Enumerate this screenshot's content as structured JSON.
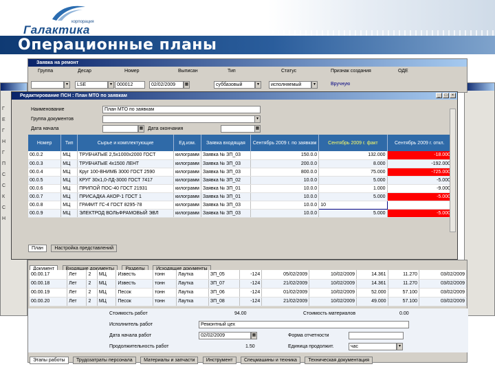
{
  "brand": {
    "logo_text": "Галактика",
    "logo_corp": "корпорация"
  },
  "slide_title": "Операционные планы",
  "zayavka_window": {
    "title": "Заявка на ремонт",
    "headers": [
      "Группа",
      "Десар",
      "Номер",
      "Выписан",
      "Тип",
      "Статус",
      "Признак создания",
      "ОДЕ"
    ],
    "row": {
      "group": "",
      "desar": "LSE",
      "number": "000012",
      "date": "02/02/2009",
      "type": "суббазовый",
      "status": "исполняемый",
      "creation": "Вручную"
    }
  },
  "psn_window": {
    "title": "Редактирование ПСН : План МТО по заявкам",
    "fields": {
      "name_label": "Наименование",
      "name_value": "План МТО по заявкам",
      "group_label": "Группа документов",
      "group_value": "",
      "start_label": "Дата начала",
      "start_value": "",
      "end_label": "Дата окончания",
      "end_value": ""
    },
    "columns": [
      "Номер",
      "Тип",
      "Сырье и комплектующие",
      "Ед.изм.",
      "Заявка входящая",
      "Сентябрь 2009 г. по заявкам",
      "Сентябрь 2009 г. факт",
      "Сентябрь 2009 г. откл."
    ],
    "rows": [
      [
        "00.0.2",
        "МЦ",
        "ТРУБЧАТЫЕ 2,5х1000х2000 ГОСТ",
        "килограмм",
        "Заявка № ЗП_03",
        "150.0.0",
        "132.000",
        "-18.000",
        "red"
      ],
      [
        "00.0.3",
        "МЦ",
        "ТРУБЧАТЫЕ 4х1500 ЛЕНТ",
        "килограмм",
        "Заявка № ЗП_03",
        "200.0.0",
        "8.000",
        "-192.000",
        "white"
      ],
      [
        "00.0.4",
        "МЦ",
        "Круг 100-ВНИМБ 3000 ГОСТ 2590",
        "килограмм",
        "Заявка № ЗП_03",
        "800.0.0",
        "75.000",
        "-725.000",
        "red"
      ],
      [
        "00.0.5",
        "МЦ",
        "КРУГ 30х1,0-ЛД-3000 ГОСТ 7417",
        "килограмм",
        "Заявка № ЗП_02",
        "10.0.0",
        "5.000",
        "-5.000",
        "white"
      ],
      [
        "00.0.6",
        "МЦ",
        "ПРИПОЙ ПОС-40 ГОСТ 21931",
        "килограмм",
        "Заявка № ЗП_01",
        "10.0.0",
        "1.000",
        "-9.000",
        "white"
      ],
      [
        "00.0.7",
        "МЦ",
        "ПРИСАДКА АКОР-1 ГОСТ 1",
        "килограмм",
        "Заявка № ЗП_01",
        "10.0.0",
        "5.000",
        "-5.000",
        "red"
      ],
      [
        "00.0.8",
        "МЦ",
        "ГРАФИТ ГС-4 ГОСТ 8295-78",
        "килограмм",
        "Заявка № ЗП_03",
        "10.0.0",
        "10",
        "",
        "selected"
      ],
      [
        "00.0.9",
        "МЦ",
        "ЭЛЕКТРОД ВОЛЬФРАМОВЫЙ ЭВЛ",
        "килограмм",
        "Заявка № ЗП_03",
        "10.0.0",
        "5.000",
        "-5.000",
        "red"
      ]
    ],
    "tabs": [
      "План",
      "Настройка представлений"
    ]
  },
  "main_window": {
    "tabs_upper": [
      "Документ",
      "Входящие документы",
      "Разделы",
      "Исходящие документы"
    ],
    "rows": [
      [
        "00.00.17",
        "Лет",
        "2",
        "МЦ",
        "Известь",
        "тонн",
        "Лаутка",
        "ЗП_05",
        "-124",
        "05/02/2009",
        "10/02/2009",
        "14.361",
        "11.270",
        "03/02/2009"
      ],
      [
        "00.00.18",
        "Лет",
        "2",
        "МЦ",
        "Известь",
        "тонн",
        "Лаутка",
        "ЗП_07",
        "-124",
        "21/02/2009",
        "10/02/2009",
        "14.361",
        "11.270",
        "03/02/2009"
      ],
      [
        "00.00.19",
        "Лет",
        "2",
        "МЦ",
        "Песок",
        "тонн",
        "Лаутка",
        "ЗП_06",
        "-124",
        "01/02/2009",
        "10/02/2009",
        "52.000",
        "57.100",
        "03/02/2009"
      ],
      [
        "00.00.20",
        "Лет",
        "2",
        "МЦ",
        "Песок",
        "тонн",
        "Лаутка",
        "ЗП_08",
        "-124",
        "21/02/2009",
        "10/02/2009",
        "49.000",
        "57.100",
        "03/02/2009"
      ]
    ],
    "form": {
      "cost_label": "Стоимость работ",
      "cost_value": "94.00",
      "material_label": "Стоимость материалов",
      "material_value": "0.00",
      "executor_label": "Исполнитель работ",
      "executor_value": "Ремонтный цех",
      "date_label": "Дата начала работ",
      "date_value": "02/02/2009",
      "form_label": "Форма отчетности",
      "form_value": "",
      "duration_label": "Продолжительность работ",
      "duration_value": "1.50",
      "unit_label": "Единица продолжит.",
      "unit_value": "час"
    },
    "tabs_bottom": [
      "Этапы работы",
      "Трудозатраты персонала",
      "Материалы и запчасти",
      "Инструмент",
      "Спецмашины и техника",
      "Техническая документация"
    ]
  },
  "colors": {
    "header_blue": "#2f6aa8",
    "alert_red": "#ff0000",
    "title_bar": "#0f3a73"
  }
}
